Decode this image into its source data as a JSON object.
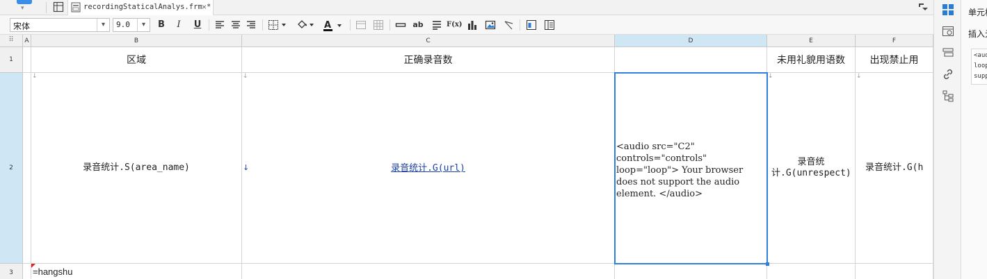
{
  "tabbar": {
    "file_tab": "recordingStaticalAnalys.frm *"
  },
  "toolbar": {
    "font_name": "宋体",
    "font_size": "9.0",
    "bold": "B",
    "italic": "I",
    "underline": "U",
    "text_ab": "ab",
    "formula": "F(x)"
  },
  "panel": {
    "title": "单元格",
    "insert_label": "插入元素",
    "code_preview_lines": [
      "<aud",
      "loop",
      "supp"
    ]
  },
  "sheet": {
    "corner": "⠿",
    "columns": [
      "A",
      "B",
      "C",
      "D",
      "E",
      "F"
    ],
    "rows": [
      "1",
      "2",
      "3"
    ],
    "header_cells": {
      "B": "区域",
      "C": "正确录音数",
      "D": "",
      "E": "未用礼貌用语数",
      "F": "出现禁止用"
    },
    "row2": {
      "B": "录音统计.S(area_name)",
      "C": "录音统计.G(url)",
      "D_audio": "<audio src=\"C2\" controls=\"controls\" loop=\"loop\"> Your browser does not support the audio element. </audio>",
      "E": "录音统计.G(unrespect)",
      "F": "录音统计.G(h"
    },
    "row3": {
      "B": "=hangshu"
    }
  },
  "colors": {
    "selection": "#2f7fe0",
    "selected_header": "#cfe6f5",
    "link": "#1a3ea8",
    "accent": "#3a8ee6"
  }
}
